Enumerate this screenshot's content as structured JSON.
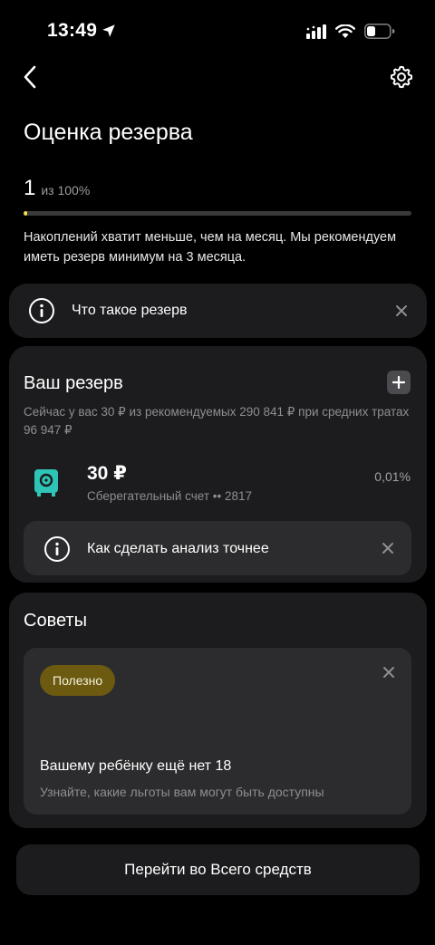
{
  "status_bar": {
    "time": "13:49",
    "icons": [
      "location-arrow-icon",
      "signal-icon",
      "wifi-icon",
      "battery-icon"
    ]
  },
  "nav": {
    "back_icon": "chevron-left-icon",
    "settings_icon": "gear-icon"
  },
  "page": {
    "title": "Оценка резерва"
  },
  "score": {
    "value": "1",
    "total": "из 100%",
    "progress_fraction": 0.01,
    "accent": "#f5e24a"
  },
  "note": "Накоплений хватит меньше, чем на месяц. Мы рекомендуем иметь резерв минимум на 3 месяца.",
  "info_banner": {
    "label": "Что такое резерв",
    "icon": "info-icon",
    "close_icon": "close-icon"
  },
  "reserve": {
    "title": "Ваш резерв",
    "add_icon": "plus-icon",
    "description": "Сейчас у вас 30 ₽ из рекомендуемых 290 841 ₽ при средних тратах 96 947 ₽",
    "account": {
      "icon": "safe-icon",
      "icon_color": "#2ec4b6",
      "amount": "30 ₽",
      "name": "Сберегательный счет •• 2817",
      "percent": "0,01%"
    },
    "hint": {
      "label": "Как сделать анализ точнее",
      "icon": "info-icon",
      "close_icon": "close-icon"
    }
  },
  "tips": {
    "title": "Советы",
    "items": [
      {
        "badge": "Полезно",
        "badge_color": "#6b5a10",
        "title": "Вашему ребёнку ещё нет 18",
        "description": "Узнайте, какие льготы вам могут быть доступны"
      }
    ]
  },
  "cta": {
    "label": "Перейти во Всего средств"
  }
}
